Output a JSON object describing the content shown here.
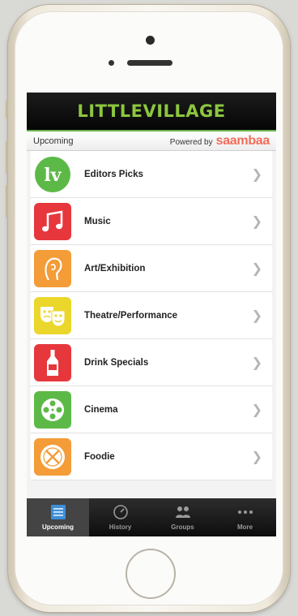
{
  "header": {
    "logo": "LITTLEVILLAGE"
  },
  "subbar": {
    "left": "Upcoming",
    "powered_prefix": "Powered by",
    "powered_brand": "saambaa"
  },
  "categories": [
    {
      "label": "Editors Picks",
      "icon": "lv-logo-icon",
      "color": "#5db947"
    },
    {
      "label": "Music",
      "icon": "music-note-icon",
      "color": "#e6373d"
    },
    {
      "label": "Art/Exhibition",
      "icon": "art-head-icon",
      "color": "#f39c38"
    },
    {
      "label": "Theatre/Performance",
      "icon": "theatre-masks-icon",
      "color": "#ebd62b"
    },
    {
      "label": "Drink Specials",
      "icon": "bottle-icon",
      "color": "#e6373d"
    },
    {
      "label": "Cinema",
      "icon": "film-reel-icon",
      "color": "#5db947"
    },
    {
      "label": "Foodie",
      "icon": "plate-utensils-icon",
      "color": "#f39c38"
    }
  ],
  "tabs": [
    {
      "label": "Upcoming",
      "icon": "calendar-list-icon",
      "active": true
    },
    {
      "label": "History",
      "icon": "clock-icon",
      "active": false
    },
    {
      "label": "Groups",
      "icon": "people-icon",
      "active": false
    },
    {
      "label": "More",
      "icon": "more-dots-icon",
      "active": false
    }
  ]
}
